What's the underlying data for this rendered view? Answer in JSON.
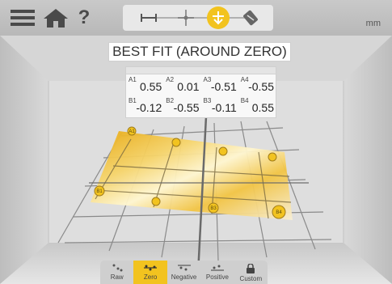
{
  "header": {
    "menu_icon": "menu-icon",
    "home_icon": "home-icon",
    "help_label": "?",
    "unit": "mm",
    "steps": [
      "distance-step-icon",
      "center-step-icon",
      "fit-step-icon",
      "calibrate-step-icon"
    ],
    "active_step": 2
  },
  "title": "BEST FIT (AROUND ZERO)",
  "table": {
    "rows": [
      [
        {
          "label": "A1",
          "value": "0.55"
        },
        {
          "label": "A2",
          "value": "0.01"
        },
        {
          "label": "A3",
          "value": "-0.51"
        },
        {
          "label": "A4",
          "value": "-0.55"
        }
      ],
      [
        {
          "label": "B1",
          "value": "-0.12"
        },
        {
          "label": "B2",
          "value": "-0.55"
        },
        {
          "label": "B3",
          "value": "-0.11"
        },
        {
          "label": "B4",
          "value": "0.55"
        }
      ]
    ]
  },
  "plane": {
    "markers": [
      "A1",
      "A2",
      "A3",
      "A4",
      "B1",
      "B2",
      "B3",
      "B4"
    ],
    "visible_labels": {
      "a1": "A1",
      "b1": "B1",
      "b3": "B3",
      "b4": "B4"
    }
  },
  "toolbar": {
    "items": [
      {
        "label": "Raw",
        "icon": "raw-icon"
      },
      {
        "label": "Zero",
        "icon": "zero-icon"
      },
      {
        "label": "Negative",
        "icon": "negative-icon"
      },
      {
        "label": "Positive",
        "icon": "positive-icon"
      },
      {
        "label": "Custom",
        "icon": "lock-icon"
      }
    ],
    "active": 1
  },
  "colors": {
    "accent": "#f2c31f",
    "plane_light": "#fff3c4",
    "plane_dark": "#e3a50a"
  }
}
